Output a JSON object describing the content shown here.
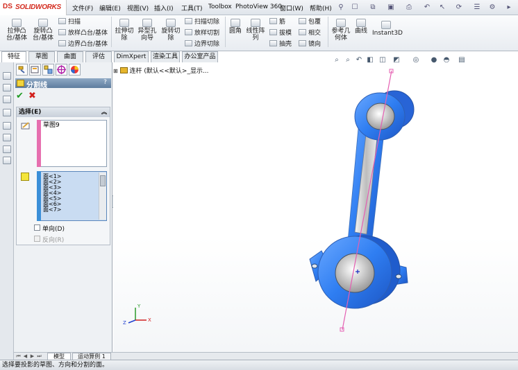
{
  "app": {
    "logo_ds": "DS",
    "logo_name": "SOLIDWORKS"
  },
  "menu": [
    {
      "label": "文件(F)"
    },
    {
      "label": "编辑(E)"
    },
    {
      "label": "视图(V)"
    },
    {
      "label": "插入(I)"
    },
    {
      "label": "工具(T)"
    },
    {
      "label": "Toolbox"
    },
    {
      "label": "PhotoView 360"
    },
    {
      "label": "窗口(W)"
    },
    {
      "label": "帮助(H)"
    }
  ],
  "ribbon": {
    "boss_extrude": "拉伸凸台/基体",
    "revolve_boss": "旋转凸台/基体",
    "sweep": "扫描",
    "loft_boss": "放样凸台/基体",
    "boundary_boss": "边界凸台/基体",
    "extrude_cut": "拉伸切除",
    "hole_wizard": "异型孔向导",
    "revolve_cut": "旋转切除",
    "sweep_cut": "扫描切除",
    "loft_cut": "放样切割",
    "boundary_cut": "边界切除",
    "fillet": "圆角",
    "linear_pattern": "线性阵列",
    "rib": "筋",
    "draft": "拔模",
    "shell": "抽壳",
    "wrap": "包覆",
    "intersect": "相交",
    "mirror": "镜向",
    "ref_geometry": "参考几何体",
    "curves": "曲线",
    "instant3d": "Instant3D"
  },
  "tabs": [
    {
      "label": "特征"
    },
    {
      "label": "草图"
    },
    {
      "label": "曲面"
    },
    {
      "label": "评估"
    },
    {
      "label": "DimXpert"
    },
    {
      "label": "渲染工具"
    },
    {
      "label": "办公室产品"
    }
  ],
  "property_manager": {
    "title": "分割线",
    "help": "?",
    "ok_symbol": "✔",
    "cancel_symbol": "✖",
    "group_title": "选择(E)",
    "sketch_item": "草图9",
    "faces": [
      "面<1>",
      "面<2>",
      "面<3>",
      "面<4>",
      "面<5>",
      "面<6>",
      "面<7>"
    ],
    "single_direction": "单向(D)",
    "reverse_direction": "反向(R)"
  },
  "tree": {
    "part_label": "连杆  (默认<<默认>_显示..."
  },
  "triad": {
    "x": "X",
    "y": "Y",
    "z": "Z"
  },
  "bottom_tabs": [
    {
      "label": "模型"
    },
    {
      "label": "运动算例 1"
    }
  ],
  "status": {
    "text": "选择要投影的草图、方向和分割的面。"
  }
}
